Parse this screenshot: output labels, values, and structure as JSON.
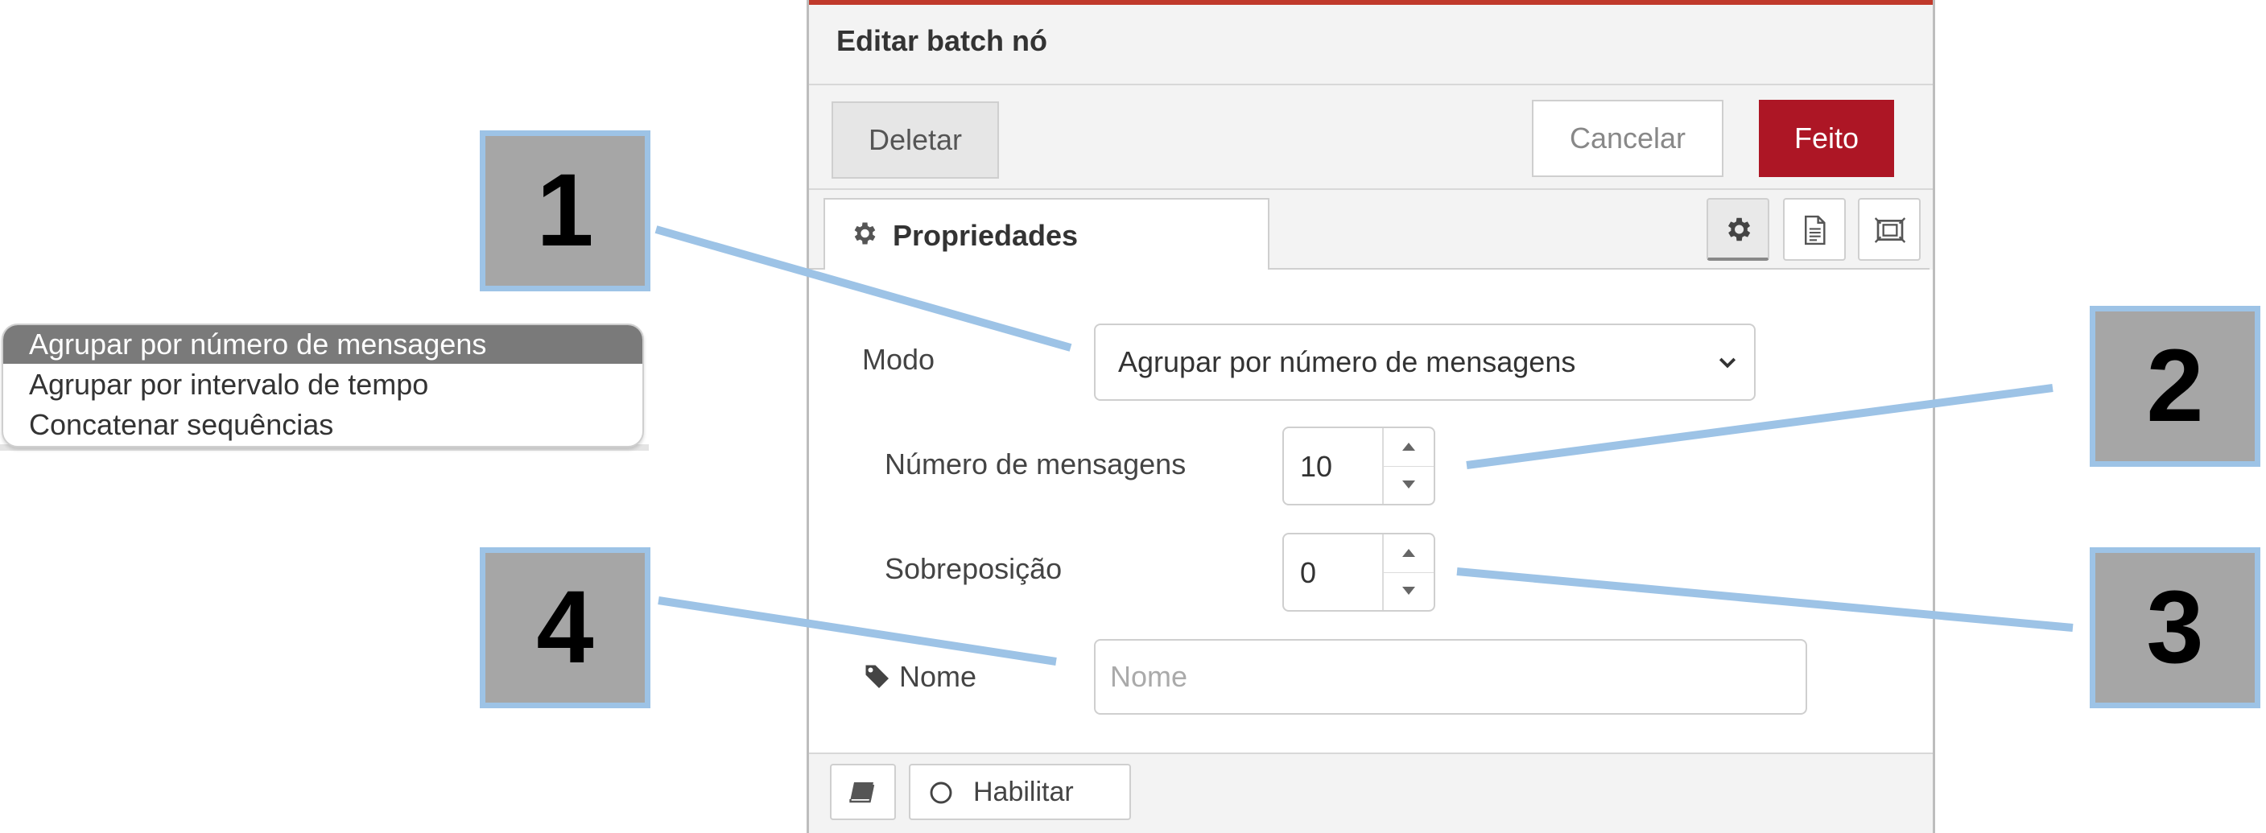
{
  "dropdown_options": [
    {
      "label": "Agrupar por número de mensagens",
      "selected": true
    },
    {
      "label": "Agrupar por intervalo de tempo",
      "selected": false
    },
    {
      "label": "Concatenar sequências",
      "selected": false
    }
  ],
  "dialog": {
    "title": "Editar batch nó",
    "delete_label": "Deletar",
    "cancel_label": "Cancelar",
    "done_label": "Feito",
    "tab_label": "Propriedades",
    "tab_buttons": [
      "gear-icon",
      "description-icon",
      "appearance-icon"
    ]
  },
  "form": {
    "modo_label": "Modo",
    "modo_value": "Agrupar por número de mensagens",
    "num_label": "Número de mensagens",
    "num_value": "10",
    "overlap_label": "Sobreposição",
    "overlap_value": "0",
    "name_label": "Nome",
    "name_placeholder": "Nome"
  },
  "footer": {
    "enable_label": "Habilitar"
  },
  "callouts": [
    "1",
    "2",
    "3",
    "4"
  ],
  "colors": {
    "accent": "#ad1625",
    "callout_fill": "#a6a6a6",
    "callout_border": "#9dc3e6",
    "selected_option": "#7a7a7a"
  }
}
